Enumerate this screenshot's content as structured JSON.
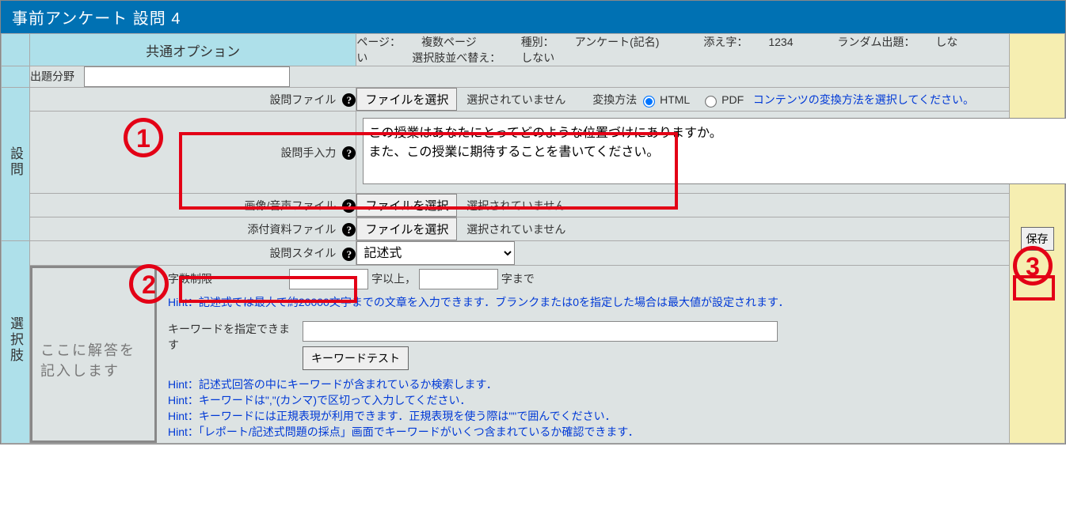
{
  "header": {
    "title": "事前アンケート  設問 4"
  },
  "common": {
    "heading": "共通オプション",
    "page_lbl": "ページ：",
    "page_val": "複数ページ",
    "type_lbl": "種別：",
    "type_val": "アンケート(記名)",
    "subscript_lbl": "添え字：",
    "subscript_val": "1234",
    "random_lbl": "ランダム出題：",
    "random_val": "しない",
    "shuffle_lbl": "選択肢並べ替え：",
    "shuffle_val": "しない",
    "field_lbl": "出題分野",
    "field_val": ""
  },
  "question": {
    "section": "設問",
    "file_lbl": "設問ファイル",
    "choose_btn": "ファイルを選択",
    "no_file": "選択されていません",
    "convert_lbl": "変換方法",
    "opt_html": "HTML",
    "opt_pdf": "PDF",
    "convert_link": "コンテンツの変換方法を選択してください。",
    "manual_lbl": "設問手入力",
    "manual_text": "この授業はあなたにとってどのような位置づけにありますか。\nまた、この授業に期待することを書いてください。",
    "media_lbl": "画像/音声ファイル",
    "attach_lbl": "添付資料ファイル",
    "style_lbl": "設問スタイル",
    "style_val": "記述式"
  },
  "choices": {
    "section": "選択肢",
    "answer_placeholder": "ここに解答を記入します",
    "limit_lbl": "字数制限",
    "limit_min": "",
    "limit_min_unit": "字以上，",
    "limit_max": "",
    "limit_max_unit": "字まで",
    "hint1": "Hint：記述式では最大で約20000文字までの文章を入力できます．ブランクまたは0を指定した場合は最大値が設定されます．",
    "kw_lbl": "キーワードを指定できます",
    "kw_val": "",
    "kw_test_btn": "キーワードテスト",
    "hint2": "Hint：記述式回答の中にキーワードが含まれているか検索します．",
    "hint3": "Hint：キーワードは\",\"(カンマ)で区切って入力してください．",
    "hint4": "Hint：キーワードには正規表現が利用できます．正規表現を使う際は\"\"で囲んでください．",
    "hint5": "Hint：「レポート/記述式問題の採点」画面でキーワードがいくつ含まれているか確認できます．"
  },
  "buttons": {
    "save": "保存"
  },
  "annotations": {
    "a1": "1",
    "a2": "2",
    "a3": "3"
  }
}
